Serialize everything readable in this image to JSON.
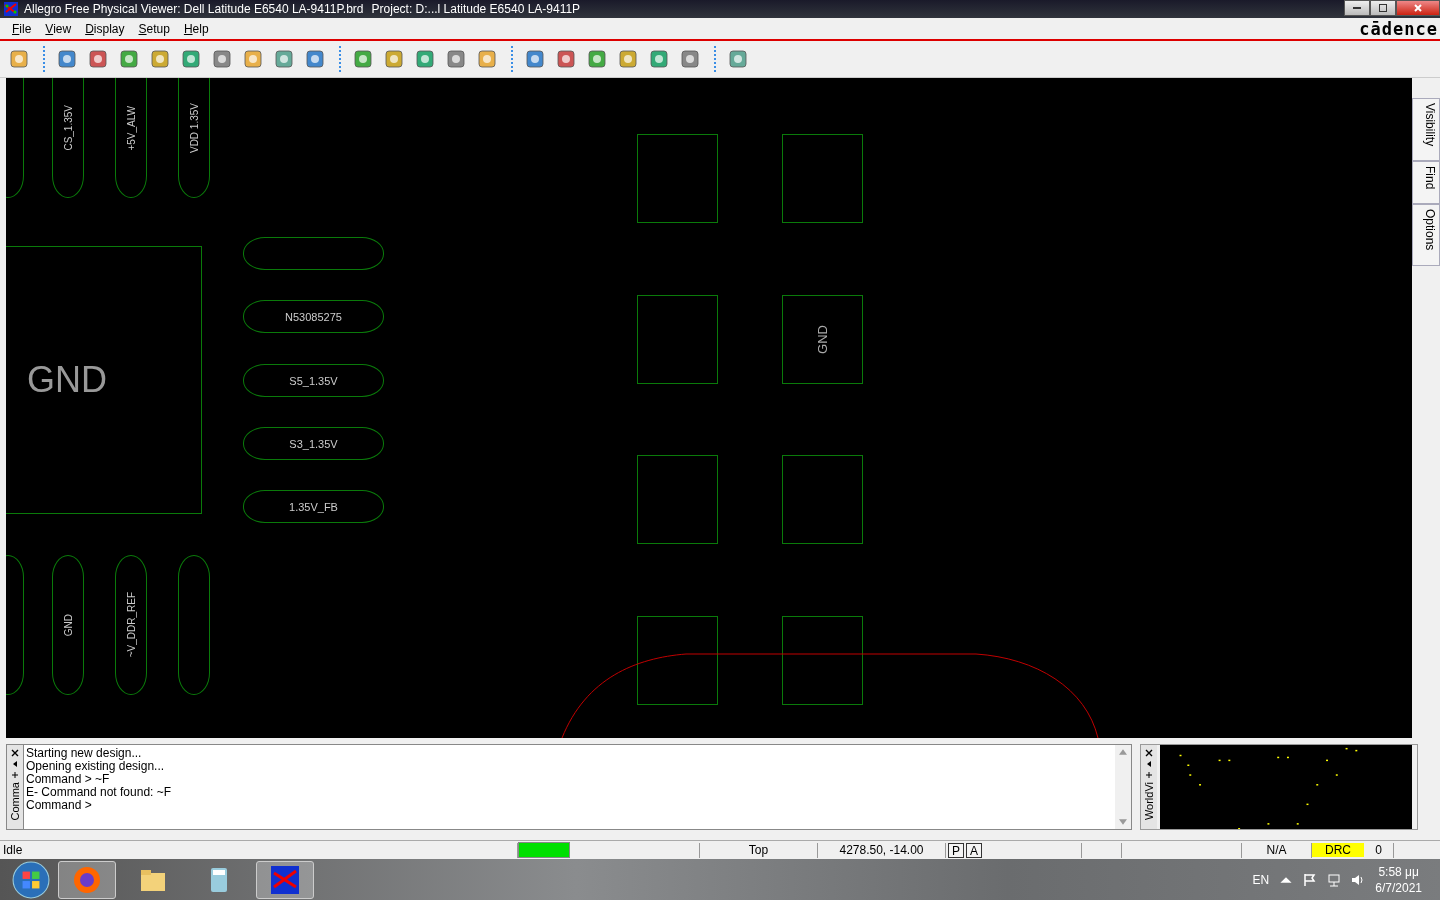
{
  "window": {
    "title": "Allegro Free Physical Viewer: Dell Latitude E6540 LA-9411P.brd",
    "project": "Project: D:...l Latitude E6540 LA-9411P"
  },
  "logo": "cādence",
  "menu": [
    "File",
    "View",
    "Display",
    "Setup",
    "Help"
  ],
  "board": {
    "top_pins": [
      "CS_1.35V",
      "+5V_ALW",
      "VDD 1.35V"
    ],
    "bottom_pins": [
      "GND",
      "~V_DDR_REF"
    ],
    "thermal_pad": "GND",
    "side_pins": [
      "N53085275",
      "S5_1.35V",
      "S3_1.35V",
      "1.35V_FB"
    ],
    "square_pads": [
      "GND"
    ]
  },
  "side_tabs": [
    "Visibility",
    "Find",
    "Options"
  ],
  "command_panel": {
    "title": "Comma",
    "lines": [
      "Starting new design...",
      "Opening existing design...",
      "Command > ~F",
      "E- Command not found: ~F",
      "Command >"
    ]
  },
  "world_view": {
    "title": "WorldVi"
  },
  "status_bar": {
    "state": "Idle",
    "layer": "Top",
    "coordinates": "4278.50, -14.00",
    "p": "P",
    "a": "A",
    "mode": "N/A",
    "drc": "DRC",
    "count": "0"
  },
  "taskbar": {
    "language": "EN",
    "time": "5:58 μμ",
    "date": "6/7/2021"
  }
}
